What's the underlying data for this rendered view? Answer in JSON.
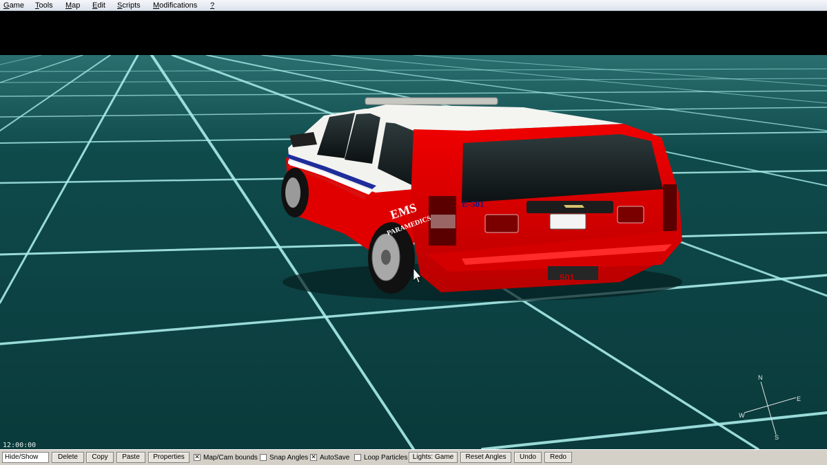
{
  "menubar": {
    "items": [
      {
        "label": "Game"
      },
      {
        "label": "Tools"
      },
      {
        "label": "Map"
      },
      {
        "label": "Edit"
      },
      {
        "label": "Scripts"
      },
      {
        "label": "Modifications"
      },
      {
        "label": "?"
      }
    ]
  },
  "vehicle": {
    "unit_label": "E-501",
    "plate": "501",
    "decal_title": "EMS",
    "decal_subtitle": "PARAMEDICS",
    "body_color": "#e00000",
    "roof_color": "#f2f2ef"
  },
  "scene": {
    "ground_color": "#0a3b3c",
    "grid_color": "#a8ecea",
    "sky_color": "#000000"
  },
  "clock": "12:00:00",
  "compass": {
    "n": "N",
    "e": "E",
    "s": "S",
    "w": "W"
  },
  "toolbar": {
    "hide_show": "Hide/Show",
    "delete": "Delete",
    "copy": "Copy",
    "paste": "Paste",
    "properties": "Properties",
    "map_cam_bounds": {
      "label": "Map/Cam bounds",
      "checked": true
    },
    "snap_angles": {
      "label": "Snap Angles",
      "checked": false
    },
    "autosave": {
      "label": "AutoSave",
      "checked": true
    },
    "loop_particles": {
      "label": "Loop Particles",
      "checked": false
    },
    "lights": "Lights: Game",
    "reset_angles": "Reset Angles",
    "undo": "Undo",
    "redo": "Redo"
  }
}
